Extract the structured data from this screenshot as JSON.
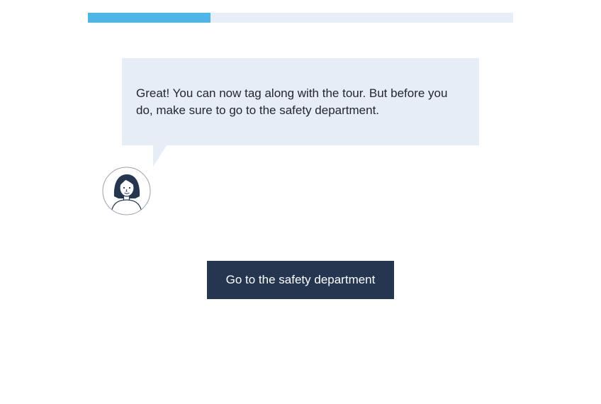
{
  "progress": {
    "fraction": 0.288,
    "fill_color": "#4db6e8",
    "track_color": "#e7eef7"
  },
  "dialogue": {
    "message": "Great! You can now tag along with the tour. But before you do, make sure to go to the safety department.",
    "bubble_color": "#e6edf6"
  },
  "speaker": {
    "avatar_icon": "woman-avatar-icon"
  },
  "actions": {
    "primary_label": "Go to the safety department",
    "primary_color": "#243650"
  }
}
